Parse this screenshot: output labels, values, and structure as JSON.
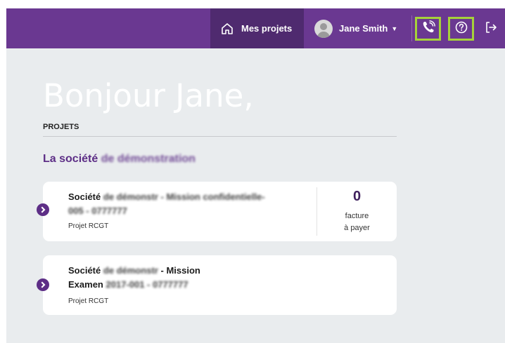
{
  "header": {
    "nav_projects_label": "Mes projets",
    "user_name": "Jane Smith",
    "accent_color": "#6a3891",
    "highlight_color": "#a6d23a",
    "icons": [
      "home-icon",
      "avatar",
      "phone-icon",
      "help-icon",
      "logout-icon"
    ]
  },
  "main": {
    "greeting": "Bonjour Jane,",
    "section_heading": "PROJETS",
    "company_prefix": "La société",
    "company_blurred": "de démonstration"
  },
  "projects": [
    {
      "title_bold": "Société",
      "title_blurred": "de démonstr - Mission confidentielle-",
      "title_line2_blurred": "005 - 0777777",
      "subtitle": "Projet RCGT",
      "count": "0",
      "count_label_line1": "facture",
      "count_label_line2": "à payer"
    },
    {
      "title_bold": "Société",
      "title_blurred": "de démonstr",
      "title_rest": "- Mission",
      "title_line2_bold": "Examen",
      "title_line2_blurred": "2017-001 - 0777777",
      "subtitle": "Projet RCGT"
    }
  ]
}
